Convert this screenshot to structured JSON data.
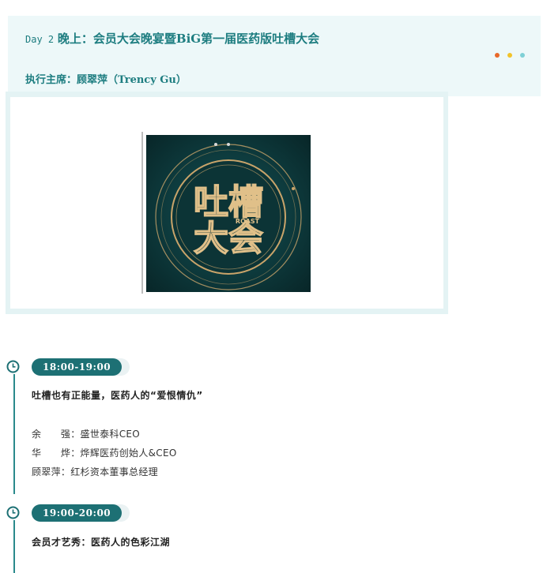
{
  "header": {
    "day_label": "Day 2",
    "title_rest": "晚上：会员大会晚宴暨BiG第一届医药版吐槽大会",
    "chair": "执行主席：顾翠萍（Trency Gu）",
    "dot_colors": [
      "#e8692a",
      "#f2c32a",
      "#7fd0d6"
    ]
  },
  "poster": {
    "title_top": "吐槽",
    "title_bottom": "大会",
    "tag": "ROAST",
    "bg_color": "#0e3b3d",
    "gold_color": "#c9a46a"
  },
  "sessions": [
    {
      "time": "18:00-19:00",
      "title": "吐槽也有正能量，医药人的“爱恨情仇”",
      "speakers": [
        {
          "name": "余　　强",
          "role": "盛世泰科CEO"
        },
        {
          "name": "华　　烨",
          "role": "烨辉医药创始人&CEO"
        },
        {
          "name": "顾翠萍",
          "role": "红杉资本董事总经理"
        }
      ]
    },
    {
      "time": "19:00-20:00",
      "title": "会员才艺秀：医药人的色彩江湖",
      "speakers": []
    }
  ]
}
